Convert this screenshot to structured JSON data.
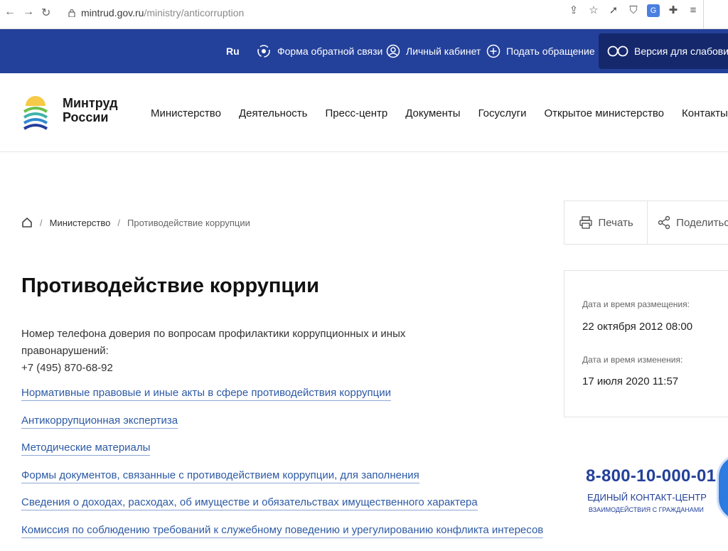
{
  "browser": {
    "url_host": "mintrud.gov.ru",
    "url_path": "/ministry/anticorruption"
  },
  "top_strip": {
    "lang": "Ru",
    "feedback": "Форма обратной связи",
    "cabinet": "Личный кабинет",
    "appeal": "Подать обращение",
    "low_vision": "Версия для слабовидящих"
  },
  "header": {
    "logo_line1": "Минтруд",
    "logo_line2": "России",
    "nav": [
      "Министерство",
      "Деятельность",
      "Пресс-центр",
      "Документы",
      "Госуслуги",
      "Открытое министерство",
      "Контакты"
    ]
  },
  "breadcrumb": {
    "item1": "Министерство",
    "current": "Противодействие коррупции"
  },
  "actions": {
    "print": "Печать",
    "share": "Поделиться"
  },
  "page": {
    "title": "Противодействие коррупции",
    "hotline_text": "Номер телефона доверия по вопросам профилактики коррупционных и иных правонарушений:",
    "hotline_phone": "+7 (495) 870-68-92",
    "links": [
      "Нормативные правовые и иные акты в сфере противодействия коррупции",
      "Антикоррупционная экспертиза",
      "Методические материалы",
      "Формы документов, связанные с противодействием коррупции, для заполнения",
      "Сведения о доходах, расходах, об имуществе и обязательствах имущественного характера",
      "Комиссия по соблюдению требований к служебному поведению и урегулированию конфликта интересов"
    ]
  },
  "meta": {
    "posted_label": "Дата и время размещения:",
    "posted_value": "22 октября 2012 08:00",
    "changed_label": "Дата и время изменения:",
    "changed_value": "17 июля 2020 11:57"
  },
  "contact": {
    "phone": "8-800-10-000-01",
    "name": "ЕДИНЫЙ КОНТАКТ-ЦЕНТР",
    "sub": "ВЗАИМОДЕЙСТВИЯ С ГРАЖДАНАМИ"
  },
  "colors": {
    "brand_blue": "#23409a",
    "link_blue": "#2d5aa5"
  }
}
